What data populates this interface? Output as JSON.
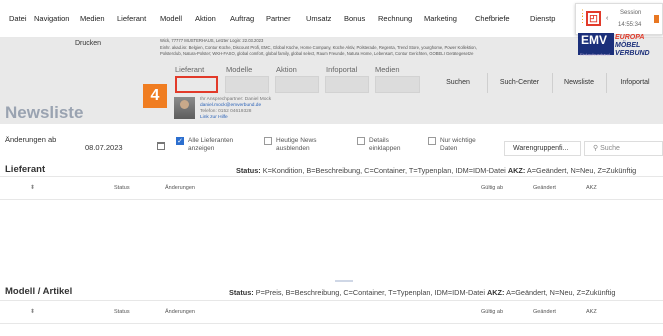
{
  "menu": [
    "Datei",
    "Navigation",
    "Medien",
    "Lieferant",
    "Modell",
    "Aktion",
    "Auftrag",
    "Partner",
    "Umsatz",
    "Bonus",
    "Rechnung",
    "Marketing",
    "Chefbriefe",
    "Dienstp"
  ],
  "session": {
    "label": "Session",
    "time": "14:55:34",
    "arrow": "‹"
  },
  "header": {
    "print_label": "Drucken",
    "info_lines": [
      "Wick, 77777 MUSTERHAUS, Letzter Login: 22.03.2023",
      "Einhr. akad.isr. Belgien, Contur Küche, Discount Profi, EMC, Global Küche, Home Company, Küche Aktiv, Polsterade, Regenta, Trend Store, yourghome, Power Kollektion,",
      "Polsterclub, Natura-Polster; WKH-FASO, global comfort, global family, global select, Raum Freunde, Natura Home, Lebensart, Contur Gerichten, GOBELI Gerätegesetze"
    ],
    "logo": {
      "emv": "EMV",
      "emv_sub": "Einkaufsverband",
      "euro1": "EUROPA",
      "euro2": "MÖBEL VERBUND"
    }
  },
  "filters": {
    "labels": [
      "Lieferant",
      "Modelle",
      "Aktion",
      "Infoportal",
      "Medien"
    ],
    "step_marker": "4"
  },
  "buttons": {
    "search": "Suchen",
    "search_center": "Such-Center",
    "newslist": "Newsliste",
    "infoportal": "Infoportal"
  },
  "contact": {
    "line1_label": "Ihr Ansprechpartner: ",
    "line1_name": "Daniel Mock",
    "email": "daniel.mock@emverbund.de",
    "phone": "Telefon:  0152 04619328",
    "help": "Link zur Hilfe"
  },
  "page_title": "Newsliste",
  "filterbar": {
    "changes_label": "Änderungen ab",
    "date": "08.07.2023",
    "all_suppliers": "Alle Lieferanten anzeigen",
    "today_news": "Heutige News ausblenden",
    "details": "Details einklappen",
    "important": "Nur wichtige Daten",
    "group_select": "Warengruppenfi...",
    "search_placeholder": "Suche"
  },
  "sections": [
    {
      "title": "Lieferant",
      "legend_status": "Status:",
      "legend_status_text": " K=Kondition, B=Beschreibung, C=Container, T=Typenplan, IDM=IDM-Datei ",
      "legend_akz": "AKZ:",
      "legend_akz_text": " A=Geändert, N=Neu, Z=Zukünftig",
      "columns": {
        "status": "Status",
        "changes": "Änderungen",
        "valid": "Gültig ab",
        "changed": "Geändert",
        "akz": "AKZ"
      }
    },
    {
      "title": "Modell / Artikel",
      "legend_status": "Status:",
      "legend_status_text": " P=Preis, B=Beschreibung, C=Container, T=Typenplan, IDM=IDM-Datei ",
      "legend_akz": "AKZ:",
      "legend_akz_text": " A=Geändert, N=Neu, Z=Zukünftig",
      "columns": {
        "status": "Status",
        "changes": "Änderungen",
        "valid": "Gültig ab",
        "changed": "Geändert",
        "akz": "AKZ"
      }
    }
  ],
  "colors": {
    "accent_orange": "#f07d21",
    "highlight_red": "#e23a2a",
    "title_gray": "#9aa3b1",
    "header_bg": "#e9e9e9",
    "checkbox_blue": "#2c6fcf"
  },
  "icons": [
    "calendar-icon",
    "search-icon",
    "sort-icon",
    "app-grid-icon",
    "session-refresh-icon"
  ]
}
